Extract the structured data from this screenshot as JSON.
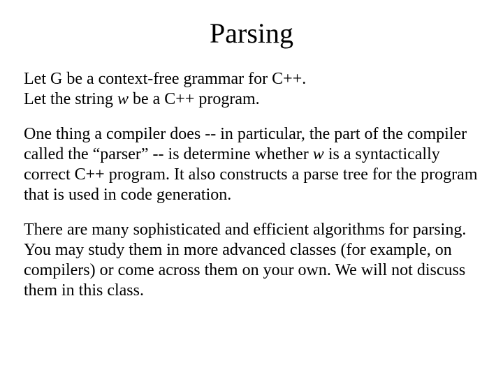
{
  "title": "Parsing",
  "p1a": "Let G be a context-free grammar for C++.",
  "p1b_pre": "Let the string ",
  "p1b_w": "w",
  "p1b_post": " be a C++ program.",
  "p2_pre": "One thing a compiler does -- in particular, the part of the compiler called the “parser” -- is determine whether ",
  "p2_w": "w",
  "p2_post": " is a syntactically correct C++ program.  It also constructs a parse tree for the program that is used in code generation.",
  "p3": "There are many sophisticated and efficient algorithms for parsing. You may study them in more advanced classes (for example, on compilers) or come across them on your own. We will not discuss them in this class."
}
